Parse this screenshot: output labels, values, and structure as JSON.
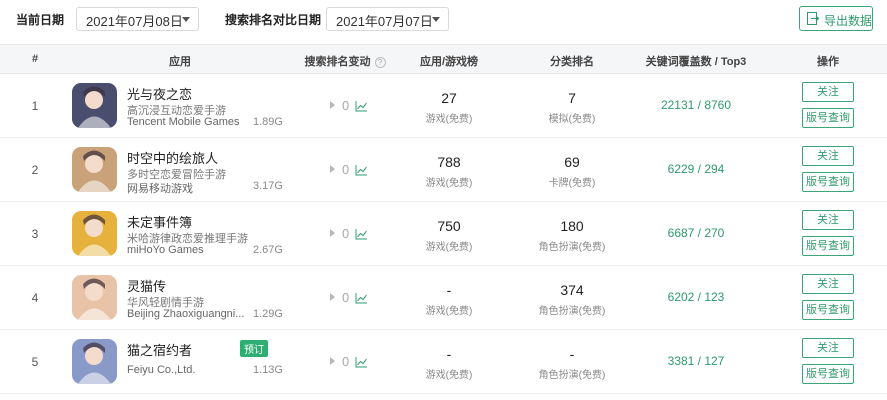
{
  "toolbar": {
    "current_date_label": "当前日期",
    "current_date_value": "2021年07月08日",
    "compare_date_label": "搜索排名对比日期",
    "compare_date_value": "2021年07月07日",
    "export_label": "导出数据"
  },
  "table": {
    "headers": {
      "index": "#",
      "app": "应用",
      "rank_change": "搜索排名变动",
      "app_game_chart": "应用/游戏榜",
      "category_rank": "分类排名",
      "keyword_coverage": "关键词覆盖数 / Top3",
      "actions": "操作"
    },
    "rows": [
      {
        "index": "1",
        "name": "光与夜之恋",
        "subtitle": "高沉浸互动恋爱手游",
        "developer": "Tencent Mobile Games",
        "size": "1.89G",
        "rank_change": "0",
        "chart_rank": "27",
        "chart_type": "游戏(免费)",
        "category_rank": "7",
        "category_type": "模拟(免费)",
        "keywords": "22131 / 8760",
        "follow": "关注",
        "query": "版号查询",
        "icon_color": "#4a4e6e"
      },
      {
        "index": "2",
        "name": "时空中的绘旅人",
        "subtitle": "多时空恋爱冒险手游",
        "developer": "网易移动游戏",
        "size": "3.17G",
        "rank_change": "0",
        "chart_rank": "788",
        "chart_type": "游戏(免费)",
        "category_rank": "69",
        "category_type": "卡牌(免费)",
        "keywords": "6229 / 294",
        "follow": "关注",
        "query": "版号查询",
        "icon_color": "#c9a27a"
      },
      {
        "index": "3",
        "name": "未定事件簿",
        "subtitle": "米哈游律政恋爱推理手游",
        "developer": "miHoYo Games",
        "size": "2.67G",
        "rank_change": "0",
        "chart_rank": "750",
        "chart_type": "游戏(免费)",
        "category_rank": "180",
        "category_type": "角色扮演(免费)",
        "keywords": "6687 / 270",
        "follow": "关注",
        "query": "版号查询",
        "icon_color": "#e6b13c"
      },
      {
        "index": "4",
        "name": "灵猫传",
        "subtitle": "华风轻剧情手游",
        "developer": "Beijing Zhaoxiguangni...",
        "size": "1.29G",
        "rank_change": "0",
        "chart_rank": "-",
        "chart_type": "游戏(免费)",
        "category_rank": "374",
        "category_type": "角色扮演(免费)",
        "keywords": "6202 / 123",
        "follow": "关注",
        "query": "版号查询",
        "icon_color": "#e9c3a8"
      },
      {
        "index": "5",
        "name": "猫之宿约者",
        "badge": "预订",
        "subtitle": "",
        "developer": "Feiyu Co.,Ltd.",
        "size": "1.13G",
        "rank_change": "0",
        "chart_rank": "-",
        "chart_type": "游戏(免费)",
        "category_rank": "-",
        "category_type": "角色扮演(免费)",
        "keywords": "3381 / 127",
        "follow": "关注",
        "query": "版号查询",
        "icon_color": "#8a9ac8"
      }
    ]
  }
}
